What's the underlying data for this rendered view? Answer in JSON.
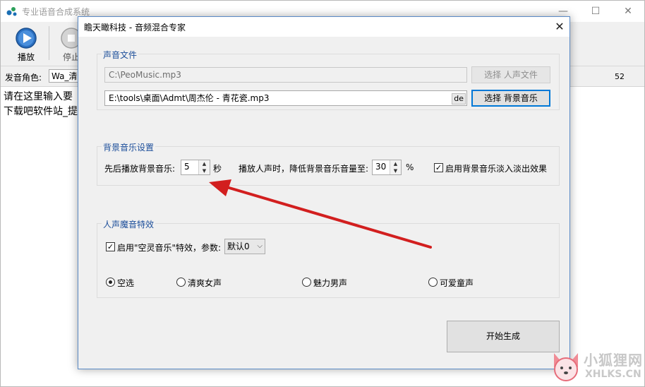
{
  "main_window": {
    "title": "专业语音合成系统",
    "controls": {
      "minimize": "—",
      "maximize": "☐",
      "close": "✕"
    },
    "toolbar": {
      "play_label": "播放",
      "stop_label": "停止"
    },
    "role_label": "发音角色:",
    "role_value": "Wa_清新",
    "role_number": "52",
    "text_lines": [
      "请在这里输入要",
      "下载吧软件站_提"
    ]
  },
  "dialog": {
    "title": "瞻天瞰科技 - 音频混合专家",
    "close": "✕",
    "sound_files": {
      "title": "声音文件",
      "voice_path": "C:\\PeoMusic.mp3",
      "voice_button": "选择 人声文件",
      "bg_path": "E:\\tools\\桌面\\Admt\\周杰伦 - 青花瓷.mp3",
      "bg_tag": "de",
      "bg_button": "选择 背景音乐"
    },
    "bg_settings": {
      "title": "背景音乐设置",
      "delay_label": "先后播放背景音乐:",
      "delay_value": "5",
      "delay_unit": "秒",
      "reduce_label": "播放人声时，降低背景音乐音量至:",
      "reduce_value": "30",
      "reduce_unit": "%",
      "fade_checked": true,
      "fade_label": "启用背景音乐淡入淡出效果"
    },
    "voice_effects": {
      "title": "人声魔音特效",
      "enable_checked": true,
      "enable_label": "启用\"空灵音乐\"特效，参数:",
      "param_value": "默认0",
      "radios": [
        {
          "label": "空选",
          "selected": true
        },
        {
          "label": "清爽女声",
          "selected": false
        },
        {
          "label": "魅力男声",
          "selected": false
        },
        {
          "label": "可爱童声",
          "selected": false
        }
      ]
    },
    "generate_button": "开始生成"
  },
  "watermark": {
    "line1": "小狐狸网",
    "line2": "XHLKS.CN"
  },
  "colors": {
    "accent": "#0078d7",
    "group_title": "#1c4e9a",
    "arrow": "#d21f1f"
  }
}
